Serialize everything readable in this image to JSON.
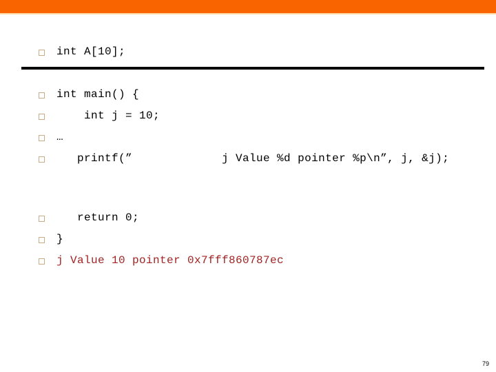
{
  "slide": {
    "accent_color": "#fa6400",
    "accent_line_color": "#fbd9a8",
    "bullet_color": "#c9ac87",
    "code_color": "#000000",
    "output_color": "#a32222",
    "page_number": "79"
  },
  "code_lines": [
    {
      "id": "decl",
      "text": "int A[10];",
      "color": "black"
    },
    {
      "id": "main",
      "text": "int main() {",
      "color": "black"
    },
    {
      "id": "intj",
      "text": "    int j = 10;",
      "color": "black"
    },
    {
      "id": "ellipsis",
      "text": "…",
      "color": "black"
    },
    {
      "id": "printf",
      "text": "   printf(”             j Value %d pointer %p\\n”, j, &j);",
      "color": "black"
    },
    {
      "id": "return",
      "text": "   return 0;",
      "color": "black"
    },
    {
      "id": "closebrace",
      "text": "}",
      "color": "black"
    },
    {
      "id": "output",
      "text": "j Value 10 pointer 0x7fff860787ec",
      "color": "red"
    }
  ]
}
